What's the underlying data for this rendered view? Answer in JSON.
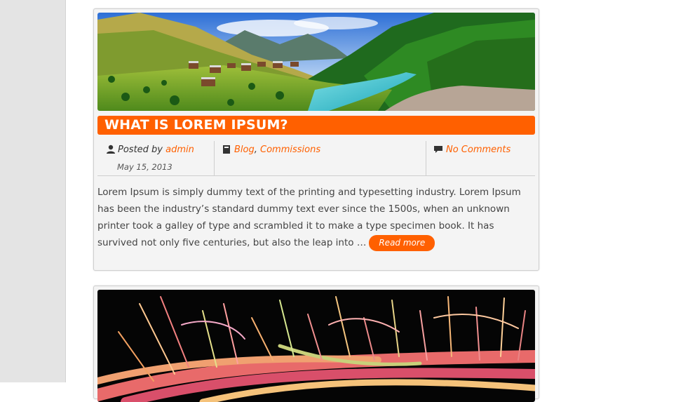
{
  "posts": [
    {
      "title": "WHAT IS LOREM IPSUM?",
      "posted_by_label": "Posted by",
      "author": "admin",
      "date": "May 15, 2013",
      "categories": [
        "Blog",
        "Commissions"
      ],
      "category_separator": ",",
      "comments": "No Comments",
      "excerpt": "Lorem Ipsum is simply dummy text of the printing and typesetting industry. Lorem Ipsum has been the industry’s standard dummy text ever since the 1500s, when an unknown printer took a galley of type and scrambled it to make a type specimen book. It has survived not only five centuries, but also the leap into …",
      "read_more": "Read more",
      "image": "mountain-valley-photo"
    },
    {
      "image": "colorful-fibers-photo"
    }
  ],
  "colors": {
    "accent": "#ff6000",
    "card_background": "#f4f4f4",
    "sidebar_strip": "#e4e4e4"
  },
  "icons": {
    "author": "user-icon",
    "categories": "book-icon",
    "comments": "speech-bubble-icon"
  }
}
